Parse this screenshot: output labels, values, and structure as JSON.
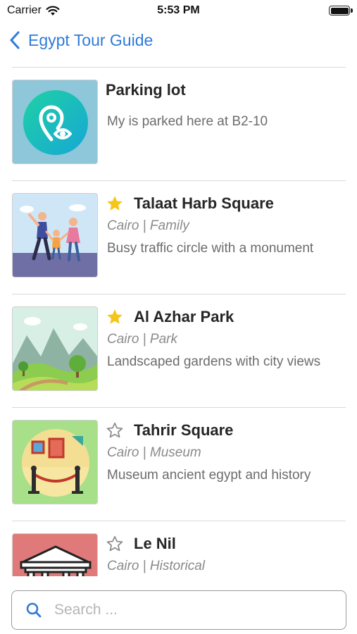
{
  "status_bar": {
    "carrier": "Carrier",
    "time": "5:53 PM"
  },
  "nav": {
    "back_label": "Egypt Tour Guide",
    "accent_color": "#2f7bd8"
  },
  "places": [
    {
      "title": "Parking lot",
      "subtitle": "",
      "description": "My is parked here at B2-10",
      "favorite": null,
      "icon": "location-eye-icon"
    },
    {
      "title": "Talaat Harb Square",
      "subtitle": "Cairo | Family",
      "description": "Busy traffic circle with a monument",
      "favorite": true,
      "icon": "family-walk-icon"
    },
    {
      "title": "Al Azhar Park",
      "subtitle": "Cairo | Park",
      "description": "Landscaped gardens with city views",
      "favorite": true,
      "icon": "park-landscape-icon"
    },
    {
      "title": "Tahrir Square",
      "subtitle": "Cairo | Museum",
      "description": "Museum ancient egypt and history",
      "favorite": false,
      "icon": "museum-gallery-icon"
    },
    {
      "title": "Le Nil",
      "subtitle": "Cairo | Historical",
      "description": "",
      "favorite": false,
      "icon": "temple-icon"
    }
  ],
  "search": {
    "placeholder": "Search ..."
  },
  "colors": {
    "star_filled": "#f5c518",
    "star_outline": "#8c8c8c"
  }
}
